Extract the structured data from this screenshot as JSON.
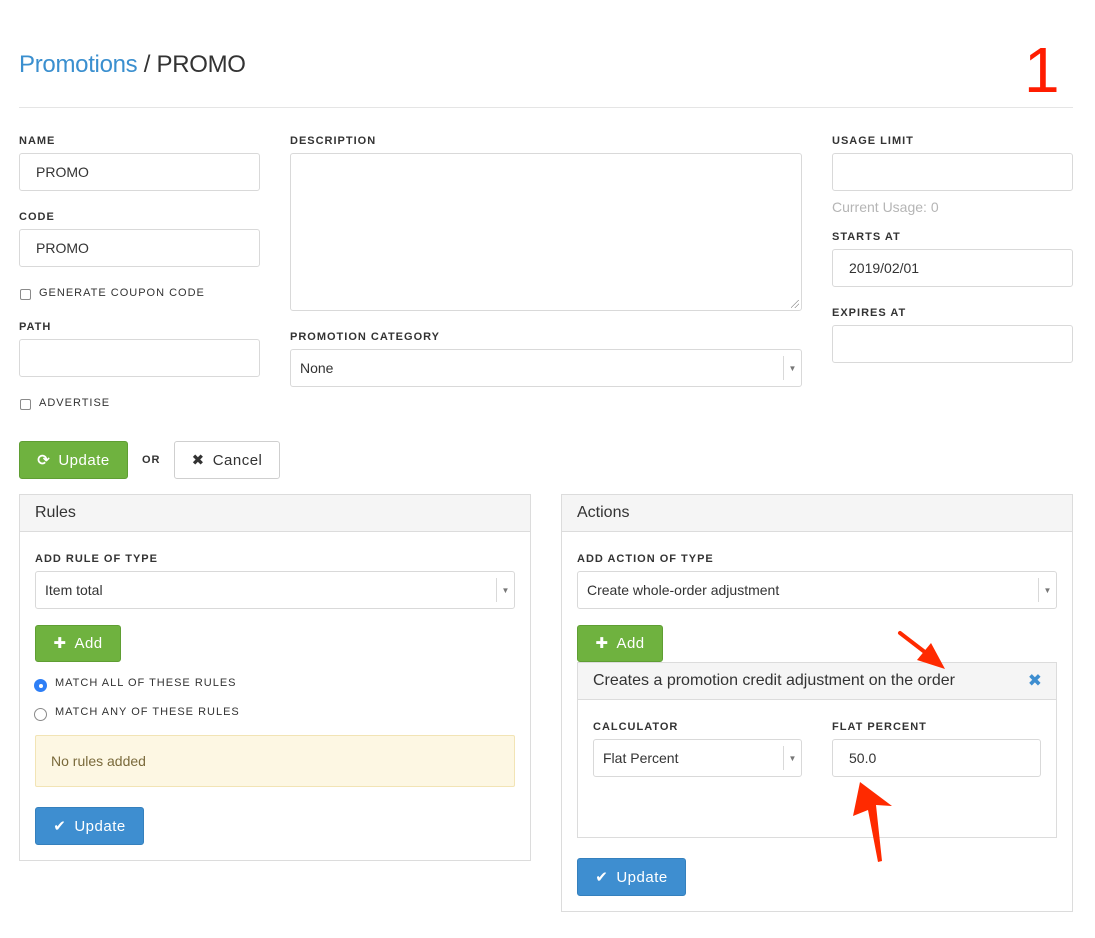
{
  "header": {
    "breadcrumb_link": "Promotions",
    "breadcrumb_separator": " / ",
    "breadcrumb_current": "PROMO",
    "annotation_number": "1"
  },
  "form": {
    "name_label": "NAME",
    "name_value": "PROMO",
    "code_label": "CODE",
    "code_value": "PROMO",
    "generate_coupon_label": "GENERATE COUPON CODE",
    "generate_coupon_checked": false,
    "path_label": "PATH",
    "path_value": "",
    "advertise_label": "ADVERTISE",
    "advertise_checked": false,
    "description_label": "DESCRIPTION",
    "description_value": "",
    "category_label": "PROMOTION CATEGORY",
    "category_value": "None",
    "usage_limit_label": "USAGE LIMIT",
    "usage_limit_value": "",
    "current_usage_text": "Current Usage: 0",
    "starts_at_label": "STARTS AT",
    "starts_at_value": "2019/02/01",
    "expires_at_label": "EXPIRES AT",
    "expires_at_value": ""
  },
  "buttons": {
    "update_label": "Update",
    "or_label": "OR",
    "cancel_label": "Cancel"
  },
  "rules": {
    "title": "Rules",
    "add_rule_label": "ADD RULE OF TYPE",
    "rule_type_value": "Item total",
    "add_button_label": "Add",
    "match_all_label": "MATCH ALL OF THESE RULES",
    "match_any_label": "MATCH ANY OF THESE RULES",
    "match_selected": "all",
    "empty_notice": "No rules added",
    "update_button_label": "Update"
  },
  "actions": {
    "title": "Actions",
    "add_action_label": "ADD ACTION OF TYPE",
    "action_type_value": "Create whole-order adjustment",
    "add_button_label": "Add",
    "action_item": {
      "title": "Creates a promotion credit adjustment on the order",
      "calculator_label": "CALCULATOR",
      "calculator_value": "Flat Percent",
      "flat_percent_label": "FLAT PERCENT",
      "flat_percent_value": "50.0"
    },
    "update_button_label": "Update"
  },
  "colors": {
    "link": "#3a8fcf",
    "success_button": "#6fb23f",
    "primary_button": "#3e8ed0",
    "annotation": "#ff1c00",
    "notice_bg": "#fdf7e3"
  },
  "icons": {
    "update": "refresh-icon",
    "cancel": "close-icon",
    "add": "plus-icon",
    "save": "checkmark-icon",
    "remove": "close-icon",
    "select": "chevron-down-icon",
    "annotation": "arrow-annotation-icon"
  }
}
